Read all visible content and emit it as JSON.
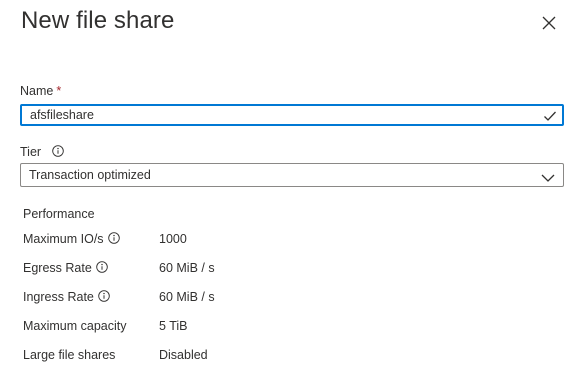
{
  "header": {
    "title": "New file share",
    "close_icon": "close-icon"
  },
  "name_field": {
    "label": "Name",
    "required_marker": "*",
    "value": "afsfileshare",
    "status_icon": "checkmark-icon"
  },
  "tier_field": {
    "label": "Tier",
    "info_icon": "info-icon",
    "selected": "Transaction optimized",
    "dropdown_icon": "chevron-down-icon"
  },
  "performance": {
    "heading": "Performance",
    "rows": [
      {
        "label": "Maximum IO/s",
        "value": "1000",
        "has_info": true
      },
      {
        "label": "Egress Rate",
        "value": "60 MiB / s",
        "has_info": true
      },
      {
        "label": "Ingress Rate",
        "value": "60 MiB / s",
        "has_info": true
      },
      {
        "label": "Maximum capacity",
        "value": "5 TiB",
        "has_info": false
      },
      {
        "label": "Large file shares",
        "value": "Disabled",
        "has_info": false
      }
    ]
  },
  "colors": {
    "accent": "#0078d4",
    "required": "#a4262c",
    "text": "#323130",
    "border": "#8a8886"
  }
}
